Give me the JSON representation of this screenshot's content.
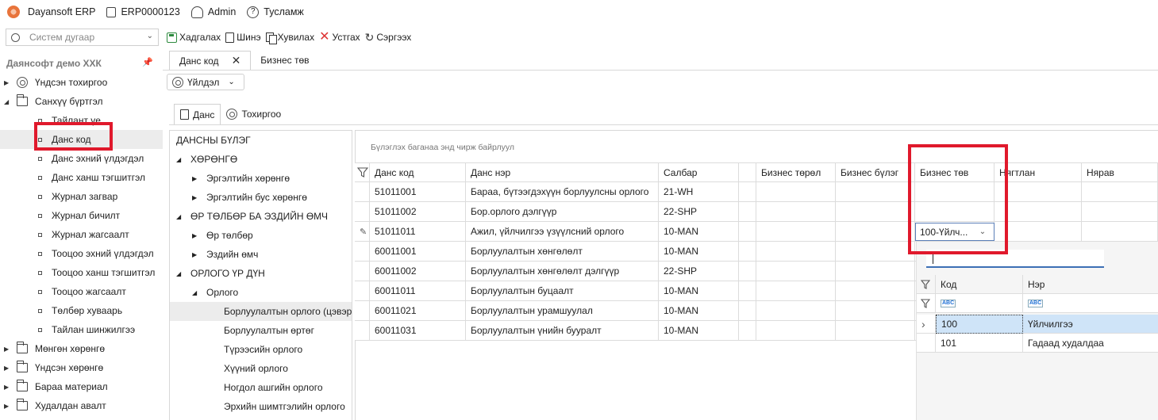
{
  "app": {
    "name": "Dayansoft ERP",
    "code": "ERP0000123",
    "user": "Admin",
    "help": "Тусламж"
  },
  "search": {
    "placeholder": "Систем дугаар"
  },
  "toolbar": {
    "save": "Хадгалах",
    "new": "Шинэ",
    "copy": "Хувилах",
    "delete": "Устгах",
    "refresh": "Сэргээх"
  },
  "sidebar": {
    "title": "Даянсофт демо ХХК",
    "items": [
      {
        "label": "Үндсэн тохиргоо",
        "level": 0,
        "icon": "gear-icon",
        "expanded": false
      },
      {
        "label": "Санхүү бүртгэл",
        "level": 0,
        "icon": "folder-icon",
        "expanded": true
      },
      {
        "label": "Тайлант үе",
        "level": 1
      },
      {
        "label": "Данс код",
        "level": 1,
        "selected": true
      },
      {
        "label": "Данс эхний үлдэгдэл",
        "level": 1
      },
      {
        "label": "Данс ханш тэгшитгэл",
        "level": 1
      },
      {
        "label": "Журнал загвар",
        "level": 1
      },
      {
        "label": "Журнал бичилт",
        "level": 1
      },
      {
        "label": "Журнал жагсаалт",
        "level": 1
      },
      {
        "label": "Тооцоо эхний үлдэгдэл",
        "level": 1
      },
      {
        "label": "Тооцоо ханш тэгшитгэл",
        "level": 1
      },
      {
        "label": "Тооцоо жагсаалт",
        "level": 1
      },
      {
        "label": "Төлбөр хуваарь",
        "level": 1
      },
      {
        "label": "Тайлан шинжилгээ",
        "level": 1
      },
      {
        "label": "Мөнгөн хөрөнгө",
        "level": 0,
        "icon": "folder-icon",
        "expanded": false
      },
      {
        "label": "Үндсэн хөрөнгө",
        "level": 0,
        "icon": "folder-icon",
        "expanded": false
      },
      {
        "label": "Бараа материал",
        "level": 0,
        "icon": "folder-icon",
        "expanded": false
      },
      {
        "label": "Худалдан авалт",
        "level": 0,
        "icon": "folder-icon",
        "expanded": false
      }
    ]
  },
  "tabs": [
    {
      "label": "Данс код",
      "active": true
    },
    {
      "label": "Бизнес төв",
      "active": false
    }
  ],
  "actions_button": "Үйлдэл",
  "subtabs": [
    {
      "label": "Данс",
      "active": true
    },
    {
      "label": "Тохиргоо",
      "active": false
    }
  ],
  "account_tree": [
    {
      "label": "ДАНСНЫ БҮЛЭГ",
      "level": 0,
      "arrow": ""
    },
    {
      "label": "ХӨРӨНГӨ",
      "level": 0,
      "arrow": "down"
    },
    {
      "label": "Эргэлтийн хөрөнгө",
      "level": 1,
      "arrow": "right"
    },
    {
      "label": "Эргэлтийн бус хөрөнгө",
      "level": 1,
      "arrow": "right"
    },
    {
      "label": "ӨР ТӨЛБӨР БА ЭЗДИЙН ӨМЧ",
      "level": 0,
      "arrow": "down"
    },
    {
      "label": "Өр төлбөр",
      "level": 1,
      "arrow": "right"
    },
    {
      "label": "Эздийн өмч",
      "level": 1,
      "arrow": "right"
    },
    {
      "label": "ОРЛОГО ҮР ДҮН",
      "level": 0,
      "arrow": "down"
    },
    {
      "label": "Орлого",
      "level": 1,
      "arrow": "down"
    },
    {
      "label": "Борлуулалтын орлого (цэвэр)",
      "level": 2,
      "arrow": "",
      "selected": true
    },
    {
      "label": "Борлуулалтын өртөг",
      "level": 2,
      "arrow": ""
    },
    {
      "label": "Түрээсийн орлого",
      "level": 2,
      "arrow": ""
    },
    {
      "label": "Хүүний орлого",
      "level": 2,
      "arrow": ""
    },
    {
      "label": "Ногдол ашгийн орлого",
      "level": 2,
      "arrow": ""
    },
    {
      "label": "Эрхийн шимтгэлийн орлого",
      "level": 2,
      "arrow": ""
    }
  ],
  "grid": {
    "group_hint": "Бүлэглэх баганаа энд чирж байрлуул",
    "columns": [
      "Данс код",
      "Данс нэр",
      "Салбар",
      "",
      "Бизнес төрөл",
      "Бизнес бүлэг",
      "Бизнес төв",
      "Нягтлан",
      "Нярав"
    ],
    "rows": [
      {
        "code": "51011001",
        "name": "Бараа, бүтээгдэхүүн борлуулсны орлого",
        "branch": "21-WH"
      },
      {
        "code": "51011002",
        "name": "Бор.орлого дэлгүүр",
        "branch": "22-SHP"
      },
      {
        "code": "51011011",
        "name": "Ажил, үйлчилгээ үзүүлсний орлого",
        "branch": "10-MAN",
        "editing": true
      },
      {
        "code": "60011001",
        "name": "Борлуулалтын хөнгөлөлт",
        "branch": "10-MAN"
      },
      {
        "code": "60011002",
        "name": "Борлуулалтын хөнгөлөлт дэлгүүр",
        "branch": "22-SHP"
      },
      {
        "code": "60011011",
        "name": "Борлуулалтын буцаалт",
        "branch": "10-MAN"
      },
      {
        "code": "60011021",
        "name": "Борлуулалтын урамшуулал",
        "branch": "10-MAN"
      },
      {
        "code": "60011031",
        "name": "Борлуулалтын үнийн бууралт",
        "branch": "10-MAN"
      }
    ]
  },
  "editor": {
    "value": "100-Үйлч..."
  },
  "dropdown": {
    "columns": [
      "Код",
      "Нэр"
    ],
    "filter_tag": "ABC",
    "rows": [
      {
        "code": "100",
        "name": "Үйлчилгээ",
        "selected": true
      },
      {
        "code": "101",
        "name": "Гадаад худалдаа"
      }
    ]
  }
}
